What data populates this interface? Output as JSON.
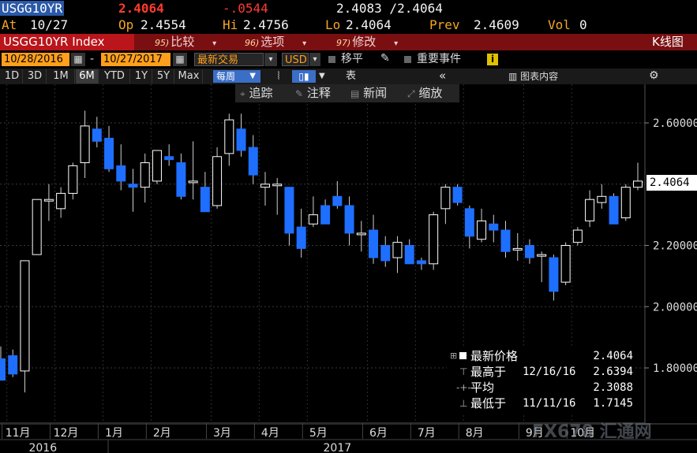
{
  "quote": {
    "ticker": "USGG10YR",
    "last": "2.4064",
    "change": "-.0544",
    "bid_ask": "2.4083 /2.4064",
    "at_label": "At",
    "at_date": "10/27",
    "op_label": "Op",
    "op": "2.4554",
    "hi_label": "Hi",
    "hi": "2.4756",
    "lo_label": "Lo",
    "lo": "2.4064",
    "prev_label": "Prev",
    "prev": "2.4609",
    "vol_label": "Vol",
    "vol": "0"
  },
  "menubar": {
    "security": "USGG10YR Index",
    "item1_num": "95)",
    "item1": "比较",
    "item2_num": "96)",
    "item2": "选项",
    "item3_num": "97)",
    "item3": "修改",
    "title": "K线图"
  },
  "daterow": {
    "start_date": "10/28/2016",
    "dash": "-",
    "end_date": "10/27/2017",
    "mode": "最新交易",
    "currency": "USD",
    "shift": "移平",
    "events": "重要事件"
  },
  "rangerow": {
    "ranges": [
      "1D",
      "3D",
      "1M",
      "6M",
      "YTD",
      "1Y",
      "5Y",
      "Max"
    ],
    "active_range": "6M",
    "period": "每周",
    "table": "表",
    "chart_content": "图表内容"
  },
  "toolbar": {
    "track": "追踪",
    "annotate": "注释",
    "news": "新闻",
    "zoom": "缩放"
  },
  "legend": {
    "last_label": "最新价格",
    "last_value": "2.4064",
    "high_label": "最高于",
    "high_date": "12/16/16",
    "high_value": "2.6394",
    "avg_label": "平均",
    "avg_value": "2.3088",
    "low_label": "最低于",
    "low_date": "11/11/16",
    "low_value": "1.7145"
  },
  "price_tag": "2.4064",
  "watermark": "FX678 汇通网",
  "colors": {
    "up": "#ffffff",
    "down": "#1e6fff",
    "accent": "#ff9f1c",
    "menu": "#7a0f12"
  },
  "chart_data": {
    "type": "candlestick",
    "interval": "weekly",
    "ylim": [
      1.7,
      2.7
    ],
    "yticks": [
      "2.60000",
      "2.20000",
      "2.00000",
      "1.80000"
    ],
    "ytick_values": [
      2.6,
      2.2,
      2.0,
      1.8
    ],
    "grid": true,
    "xlabels": [
      "11月",
      "12月",
      "1月",
      "2月",
      "3月",
      "4月",
      "5月",
      "6月",
      "7月",
      "8月",
      "9月",
      "10月"
    ],
    "xlabel_week_index": [
      1,
      5,
      9,
      13,
      18,
      22,
      26,
      31,
      35,
      39,
      44,
      48
    ],
    "years": [
      "2016",
      "2017"
    ],
    "year_week_index": [
      3.5,
      28
    ],
    "candles": [
      {
        "o": 1.83,
        "h": 1.87,
        "l": 1.76,
        "c": 1.76
      },
      {
        "o": 1.84,
        "h": 1.86,
        "l": 1.77,
        "c": 1.78
      },
      {
        "o": 1.79,
        "h": 1.87,
        "l": 1.72,
        "c": 2.15
      },
      {
        "o": 2.17,
        "h": 2.35,
        "l": 2.17,
        "c": 2.35
      },
      {
        "o": 2.35,
        "h": 2.4,
        "l": 2.28,
        "c": 2.35
      },
      {
        "o": 2.32,
        "h": 2.39,
        "l": 2.29,
        "c": 2.37
      },
      {
        "o": 2.37,
        "h": 2.47,
        "l": 2.35,
        "c": 2.46
      },
      {
        "o": 2.47,
        "h": 2.64,
        "l": 2.42,
        "c": 2.59
      },
      {
        "o": 2.58,
        "h": 2.62,
        "l": 2.52,
        "c": 2.54
      },
      {
        "o": 2.55,
        "h": 2.59,
        "l": 2.44,
        "c": 2.45
      },
      {
        "o": 2.46,
        "h": 2.53,
        "l": 2.38,
        "c": 2.41
      },
      {
        "o": 2.4,
        "h": 2.45,
        "l": 2.31,
        "c": 2.39
      },
      {
        "o": 2.39,
        "h": 2.5,
        "l": 2.34,
        "c": 2.47
      },
      {
        "o": 2.41,
        "h": 2.51,
        "l": 2.4,
        "c": 2.51
      },
      {
        "o": 2.49,
        "h": 2.53,
        "l": 2.46,
        "c": 2.48
      },
      {
        "o": 2.47,
        "h": 2.5,
        "l": 2.35,
        "c": 2.36
      },
      {
        "o": 2.41,
        "h": 2.54,
        "l": 2.35,
        "c": 2.41
      },
      {
        "o": 2.39,
        "h": 2.44,
        "l": 2.31,
        "c": 2.31
      },
      {
        "o": 2.33,
        "h": 2.52,
        "l": 2.32,
        "c": 2.49
      },
      {
        "o": 2.5,
        "h": 2.63,
        "l": 2.46,
        "c": 2.61
      },
      {
        "o": 2.58,
        "h": 2.63,
        "l": 2.49,
        "c": 2.51
      },
      {
        "o": 2.52,
        "h": 2.56,
        "l": 2.4,
        "c": 2.43
      },
      {
        "o": 2.39,
        "h": 2.44,
        "l": 2.33,
        "c": 2.4
      },
      {
        "o": 2.4,
        "h": 2.42,
        "l": 2.3,
        "c": 2.4
      },
      {
        "o": 2.39,
        "h": 2.39,
        "l": 2.2,
        "c": 2.24
      },
      {
        "o": 2.26,
        "h": 2.32,
        "l": 2.16,
        "c": 2.19
      },
      {
        "o": 2.27,
        "h": 2.36,
        "l": 2.26,
        "c": 2.3
      },
      {
        "o": 2.33,
        "h": 2.35,
        "l": 2.31,
        "c": 2.27
      },
      {
        "o": 2.36,
        "h": 2.41,
        "l": 2.32,
        "c": 2.33
      },
      {
        "o": 2.33,
        "h": 2.36,
        "l": 2.2,
        "c": 2.24
      },
      {
        "o": 2.24,
        "h": 2.28,
        "l": 2.18,
        "c": 2.24
      },
      {
        "o": 2.25,
        "h": 2.3,
        "l": 2.14,
        "c": 2.16
      },
      {
        "o": 2.2,
        "h": 2.23,
        "l": 2.13,
        "c": 2.15
      },
      {
        "o": 2.16,
        "h": 2.23,
        "l": 2.11,
        "c": 2.21
      },
      {
        "o": 2.2,
        "h": 2.22,
        "l": 2.14,
        "c": 2.14
      },
      {
        "o": 2.15,
        "h": 2.16,
        "l": 2.12,
        "c": 2.14
      },
      {
        "o": 2.14,
        "h": 2.31,
        "l": 2.12,
        "c": 2.3
      },
      {
        "o": 2.32,
        "h": 2.4,
        "l": 2.27,
        "c": 2.39
      },
      {
        "o": 2.39,
        "h": 2.4,
        "l": 2.33,
        "c": 2.34
      },
      {
        "o": 2.32,
        "h": 2.33,
        "l": 2.19,
        "c": 2.23
      },
      {
        "o": 2.22,
        "h": 2.32,
        "l": 2.21,
        "c": 2.28
      },
      {
        "o": 2.27,
        "h": 2.3,
        "l": 2.21,
        "c": 2.25
      },
      {
        "o": 2.25,
        "h": 2.28,
        "l": 2.16,
        "c": 2.18
      },
      {
        "o": 2.19,
        "h": 2.24,
        "l": 2.15,
        "c": 2.19
      },
      {
        "o": 2.2,
        "h": 2.22,
        "l": 2.14,
        "c": 2.16
      },
      {
        "o": 2.17,
        "h": 2.18,
        "l": 2.08,
        "c": 2.17
      },
      {
        "o": 2.16,
        "h": 2.17,
        "l": 2.02,
        "c": 2.05
      },
      {
        "o": 2.08,
        "h": 2.21,
        "l": 2.07,
        "c": 2.2
      },
      {
        "o": 2.21,
        "h": 2.26,
        "l": 2.2,
        "c": 2.25
      },
      {
        "o": 2.28,
        "h": 2.38,
        "l": 2.26,
        "c": 2.35
      },
      {
        "o": 2.34,
        "h": 2.4,
        "l": 2.32,
        "c": 2.36
      },
      {
        "o": 2.36,
        "h": 2.37,
        "l": 2.27,
        "c": 2.27
      },
      {
        "o": 2.29,
        "h": 2.4,
        "l": 2.28,
        "c": 2.39
      },
      {
        "o": 2.39,
        "h": 2.47,
        "l": 2.38,
        "c": 2.41
      }
    ]
  }
}
